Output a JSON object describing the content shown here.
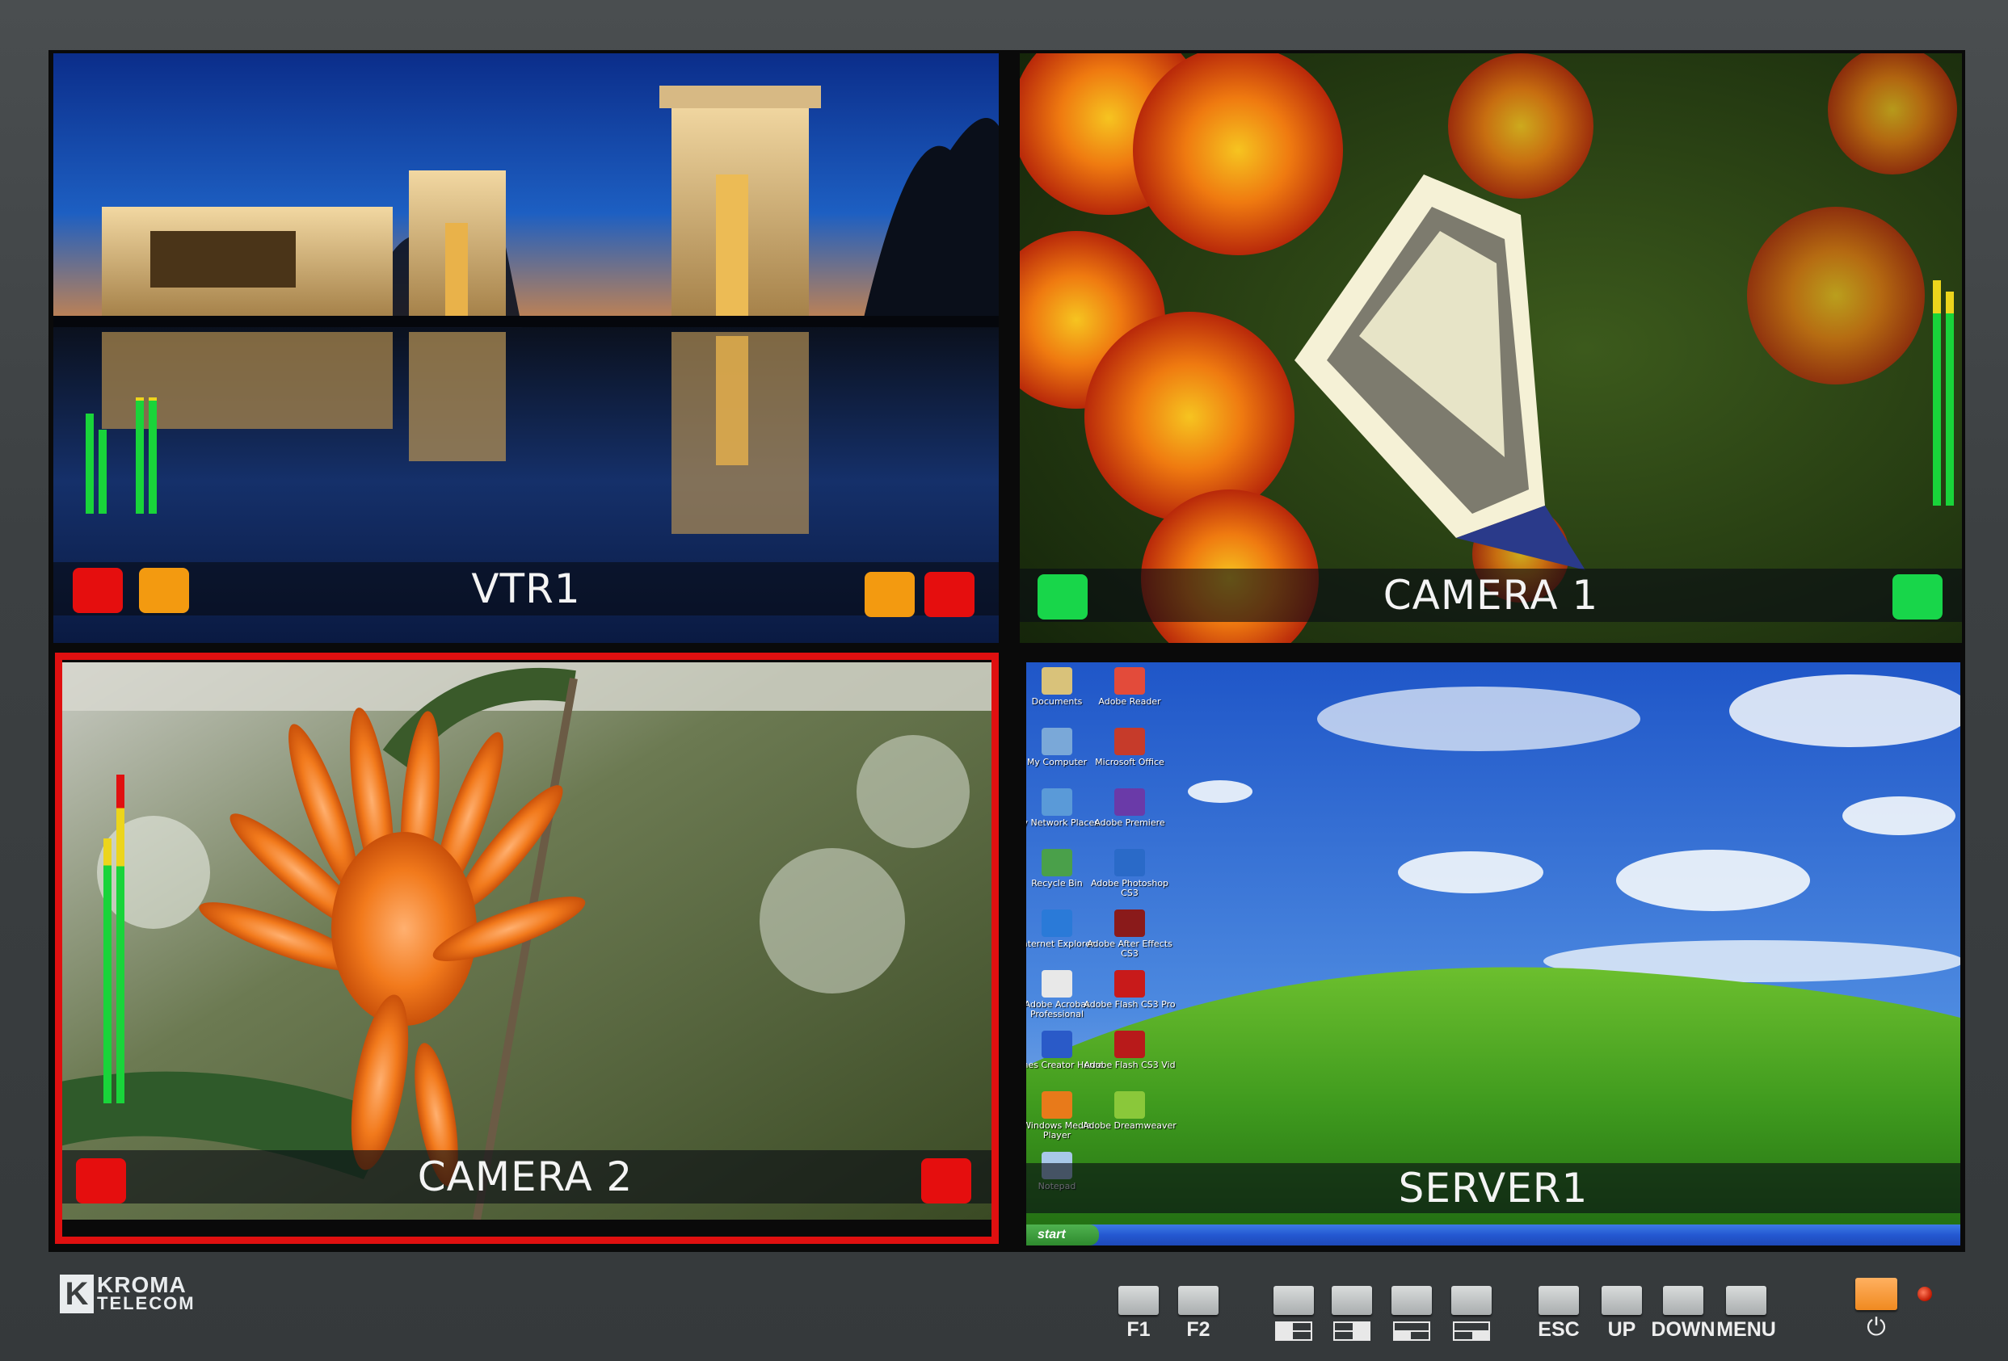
{
  "brand": {
    "logo_k": "K",
    "logo_line1": "KROMA",
    "logo_line2": "TELECOM"
  },
  "panes": [
    {
      "id": "vtr1",
      "label": "VTR1",
      "selected": false,
      "tally_left": [
        "#e50e0e",
        "#f39a10"
      ],
      "tally_right": [
        "#f39a10",
        "#e50e0e"
      ],
      "audio_levels": [
        0.62,
        0.52,
        0.72,
        0.72
      ]
    },
    {
      "id": "camera1",
      "label": "CAMERA 1",
      "selected": false,
      "tally_left": [
        "#18d64a"
      ],
      "tally_right": [
        "#18d64a"
      ],
      "audio_levels": [
        0.82,
        0.78
      ]
    },
    {
      "id": "camera2",
      "label": "CAMERA 2",
      "selected": true,
      "tally_left": [
        "#e50e0e"
      ],
      "tally_right": [
        "#e50e0e"
      ],
      "audio_levels": [
        0.78,
        0.97
      ]
    },
    {
      "id": "server1",
      "label": "SERVER1",
      "selected": false,
      "tally_left": [],
      "tally_right": [],
      "audio_levels": []
    }
  ],
  "desktop": {
    "icons": [
      "Documents",
      "Adobe Reader",
      "My Computer",
      "Microsoft Office",
      "My Network Places",
      "Adobe Premiere",
      "Recycle Bin",
      "Adobe Photoshop CS3",
      "Internet Explorer",
      "Adobe After Effects CS3",
      "Adobe Acrobat Professional",
      "Adobe Flash CS3 Pro",
      "iTunes Creator Home",
      "Adobe Flash CS3 Vid",
      "Windows Media Player",
      "Adobe Dreamweaver",
      "Notepad"
    ],
    "start_label": "start"
  },
  "controls": {
    "buttons": [
      "F1",
      "F2",
      "",
      "",
      "",
      "",
      "ESC",
      "UP",
      "DOWN",
      "MENU"
    ],
    "layout_icons": [
      "split-left-icon",
      "split-right-icon",
      "split-bottom-left-icon",
      "split-bottom-right-icon"
    ],
    "power_symbol": "⏻",
    "colors": {
      "power": "#f0902a",
      "led": "#d01e00"
    }
  },
  "colors": {
    "selection": "#e01010",
    "meter_green": "#19d43a",
    "meter_yellow": "#ecd51c",
    "meter_red": "#e01010"
  }
}
